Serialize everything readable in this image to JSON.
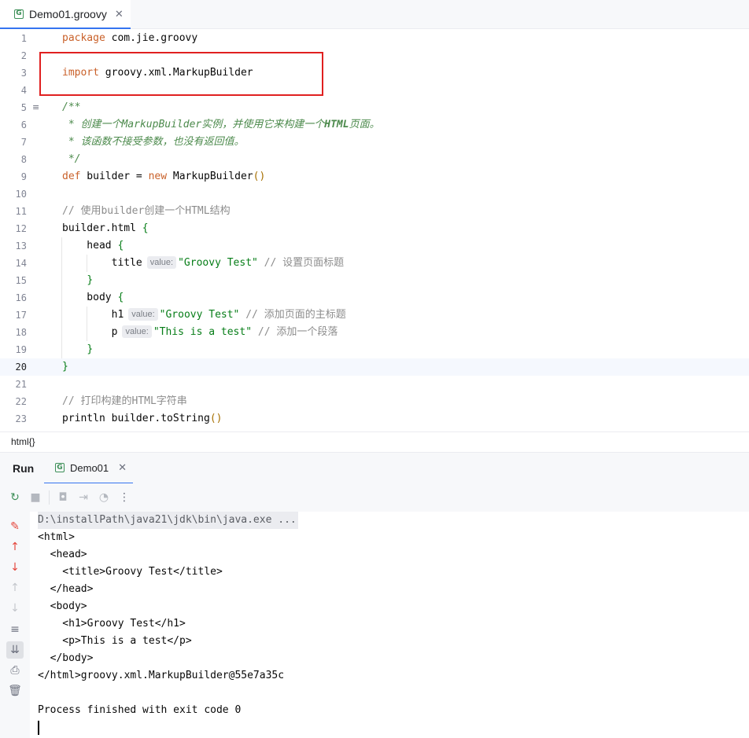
{
  "editor_tab": {
    "label": "Demo01.groovy",
    "icon": "groovy-file-icon"
  },
  "code_lines": [
    {
      "n": "1",
      "tokens": [
        {
          "t": "package",
          "c": "kw2"
        },
        {
          "t": " com.jie.groovy",
          "c": ""
        }
      ]
    },
    {
      "n": "2",
      "tokens": []
    },
    {
      "n": "3",
      "tokens": [
        {
          "t": "import",
          "c": "kw2"
        },
        {
          "t": " groovy.xml.MarkupBuilder",
          "c": ""
        }
      ]
    },
    {
      "n": "4",
      "tokens": []
    },
    {
      "n": "5",
      "tokens": [
        {
          "t": "/**",
          "c": "doc"
        }
      ]
    },
    {
      "n": "6",
      "tokens": [
        {
          "t": " * 创建一个",
          "c": "doc"
        },
        {
          "t": "MarkupBuilder",
          "c": "doc"
        },
        {
          "t": "实例，并使用它来构建一个",
          "c": "doc"
        },
        {
          "t": "HTML",
          "c": "docb"
        },
        {
          "t": "页面。",
          "c": "doc"
        }
      ]
    },
    {
      "n": "7",
      "tokens": [
        {
          "t": " * 该函数不接受参数，也没有返回值。",
          "c": "doc"
        }
      ]
    },
    {
      "n": "8",
      "tokens": [
        {
          "t": " */",
          "c": "doc"
        }
      ]
    },
    {
      "n": "9",
      "tokens": [
        {
          "t": "def",
          "c": "kw2"
        },
        {
          "t": " builder = ",
          "c": ""
        },
        {
          "t": "new",
          "c": "kw2"
        },
        {
          "t": " MarkupBuilder",
          "c": ""
        },
        {
          "t": "()",
          "c": "paren"
        }
      ]
    },
    {
      "n": "10",
      "tokens": []
    },
    {
      "n": "11",
      "tokens": [
        {
          "t": "// 使用builder创建一个HTML结构",
          "c": "cm"
        }
      ]
    },
    {
      "n": "12",
      "tokens": [
        {
          "t": "builder.html ",
          "c": ""
        },
        {
          "t": "{",
          "c": "brace"
        }
      ]
    },
    {
      "n": "13",
      "tokens": [
        {
          "t": "    head ",
          "c": ""
        },
        {
          "t": "{",
          "c": "brace"
        }
      ]
    },
    {
      "n": "14",
      "tokens": [
        {
          "t": "        title",
          "c": ""
        },
        {
          "t": "value:",
          "c": "hint"
        },
        {
          "t": "\"Groovy Test\"",
          "c": "str"
        },
        {
          "t": " // 设置页面标题",
          "c": "cm"
        }
      ]
    },
    {
      "n": "15",
      "tokens": [
        {
          "t": "    ",
          "c": ""
        },
        {
          "t": "}",
          "c": "brace"
        }
      ]
    },
    {
      "n": "16",
      "tokens": [
        {
          "t": "    body ",
          "c": ""
        },
        {
          "t": "{",
          "c": "brace"
        }
      ]
    },
    {
      "n": "17",
      "tokens": [
        {
          "t": "        h1",
          "c": ""
        },
        {
          "t": "value:",
          "c": "hint"
        },
        {
          "t": "\"Groovy Test\"",
          "c": "str"
        },
        {
          "t": " // 添加页面的主标题",
          "c": "cm"
        }
      ]
    },
    {
      "n": "18",
      "tokens": [
        {
          "t": "        p",
          "c": ""
        },
        {
          "t": "value:",
          "c": "hint"
        },
        {
          "t": "\"This is a test\"",
          "c": "str"
        },
        {
          "t": " // 添加一个段落",
          "c": "cm"
        }
      ]
    },
    {
      "n": "19",
      "tokens": [
        {
          "t": "    ",
          "c": ""
        },
        {
          "t": "}",
          "c": "brace"
        }
      ]
    },
    {
      "n": "20",
      "tokens": [
        {
          "t": "}",
          "c": "brace"
        }
      ],
      "current": true
    },
    {
      "n": "21",
      "tokens": []
    },
    {
      "n": "22",
      "tokens": [
        {
          "t": "// 打印构建的HTML字符串",
          "c": "cm"
        }
      ]
    },
    {
      "n": "23",
      "tokens": [
        {
          "t": "println builder.toString",
          "c": ""
        },
        {
          "t": "()",
          "c": "paren"
        }
      ]
    }
  ],
  "breadcrumb": {
    "text": "html{}"
  },
  "run_panel": {
    "title": "Run",
    "tab_label": "Demo01",
    "toolbar_icons": [
      "rerun-icon",
      "stop-icon",
      "screenshot-icon",
      "restore-layout-icon",
      "coverage-icon",
      "more-options-icon"
    ],
    "side_icons": [
      "pin-icon",
      "scroll-up-icon",
      "scroll-down-icon",
      "up-arrow-icon",
      "down-arrow-icon",
      "soft-wrap-icon",
      "scroll-to-end-icon",
      "print-icon",
      "trash-icon"
    ]
  },
  "console_lines": [
    {
      "text": "D:\\installPath\\java21\\jdk\\bin\\java.exe ...",
      "cmd": true
    },
    {
      "text": "<html>"
    },
    {
      "text": "  <head>"
    },
    {
      "text": "    <title>Groovy Test</title>"
    },
    {
      "text": "  </head>"
    },
    {
      "text": "  <body>"
    },
    {
      "text": "    <h1>Groovy Test</h1>"
    },
    {
      "text": "    <p>This is a test</p>"
    },
    {
      "text": "  </body>"
    },
    {
      "text": "</html>groovy.xml.MarkupBuilder@55e7a35c"
    },
    {
      "text": ""
    },
    {
      "text": "Process finished with exit code 0"
    }
  ],
  "colors": {
    "accent": "#3574f0",
    "highlight_box": "#e02020",
    "groovy_green": "#3d8f58"
  }
}
